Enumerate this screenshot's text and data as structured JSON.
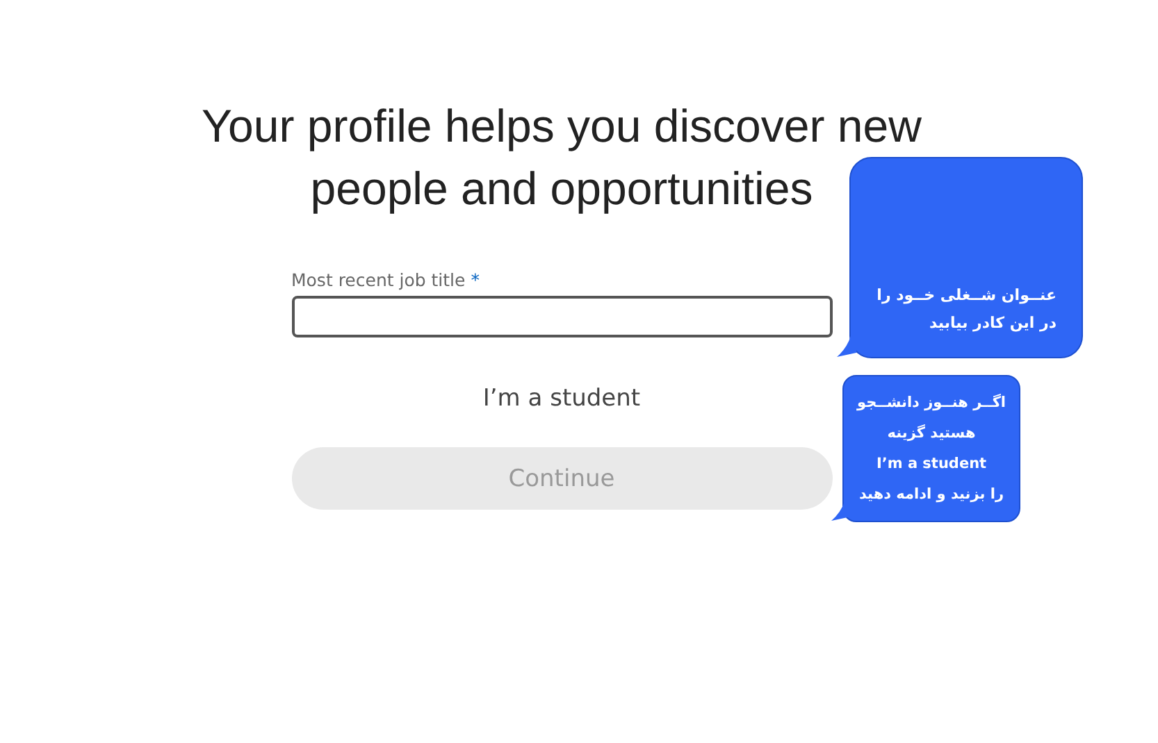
{
  "heading": "Your profile helps you discover new people and opportunities",
  "job_title_field": {
    "label": "Most recent job title",
    "required_mark": "*",
    "focused": true
  },
  "student_link": "I’m a student",
  "continue_button": {
    "label": "Continue",
    "disabled": true
  },
  "callouts": [
    {
      "text": "عنــوان شــغلی خــود را\nدر این کادر بیابید"
    },
    {
      "text": "اگــر هنــوز دانشــجو\nهستید گزینه\nI’m a student\nرا بزنید و ادامه دهید"
    }
  ]
}
